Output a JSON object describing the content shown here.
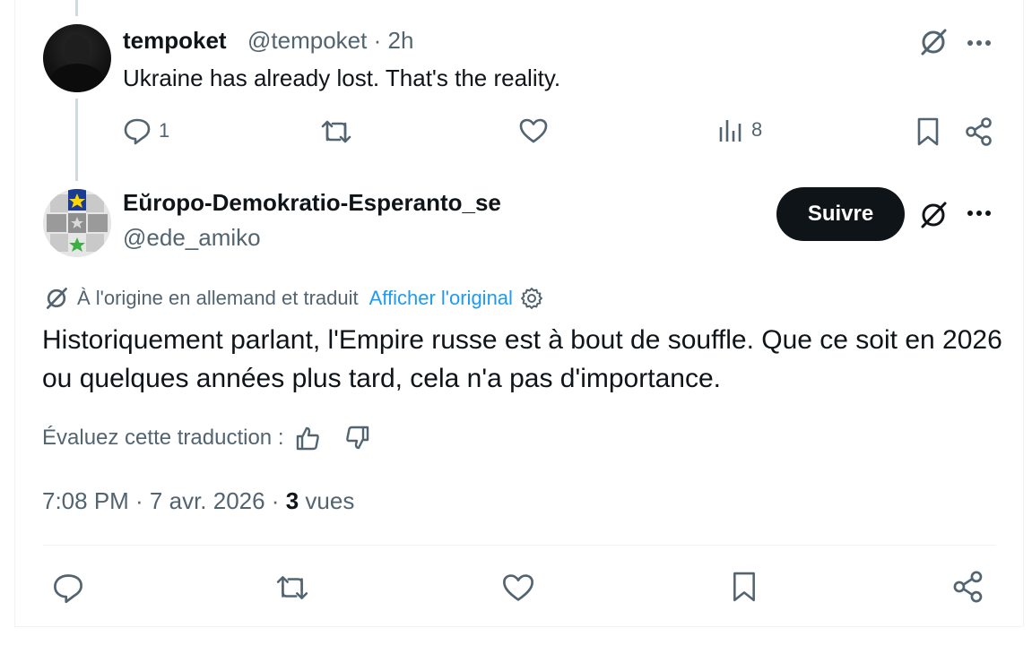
{
  "reply_parent": {
    "display_name": "tempoket",
    "handle": "@tempoket",
    "separator": "·",
    "time": "2h",
    "text": "Ukraine has already lost. That's the reality.",
    "reply_count": "1",
    "views_count": "8"
  },
  "main_tweet": {
    "display_name": "Eŭropo-Demokratio-Esperanto_se",
    "handle": "@ede_amiko",
    "follow_label": "Suivre",
    "translation_note": "À l'origine en allemand et traduit",
    "show_original": "Afficher l'original",
    "text": "Historiquement parlant, l'Empire russe est à bout de souffle. Que ce soit en 2026 ou quelques années plus tard, cela n'a pas d'importance.",
    "rate_label": "Évaluez cette traduction :",
    "timestamp": "7:08 PM · 7 avr. 2026 · ",
    "views_count": "3",
    "views_label": " vues"
  },
  "colors": {
    "text": "#0f1419",
    "secondary": "#536471",
    "link": "#1d9bf0",
    "border": "#eff3f4",
    "button_bg": "#0f1419"
  }
}
